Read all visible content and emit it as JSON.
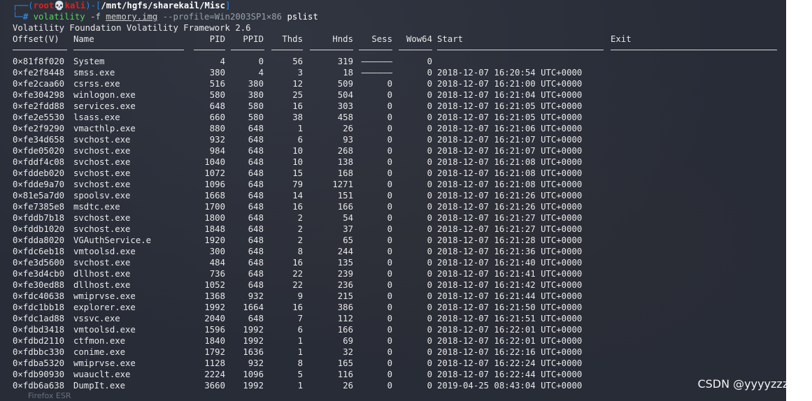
{
  "prompt": {
    "user": "root",
    "skull": "💀",
    "host": "kali",
    "path": "/mnt/hgfs/sharekail/Misc",
    "hash": "#",
    "command": "volatility",
    "flag": "-f",
    "file": "memory.img",
    "profile": "--profile=Win2003SP1×86",
    "plugin": "pslist"
  },
  "banner": "Volatility Foundation Volatility Framework 2.6",
  "headers": {
    "offset": "Offset(V)",
    "name": "Name",
    "pid": "PID",
    "ppid": "PPID",
    "thds": "Thds",
    "hnds": "Hnds",
    "sess": "Sess",
    "wow64": "Wow64",
    "start": "Start",
    "exit": "Exit"
  },
  "rows": [
    {
      "offset": "0×81f8f020",
      "name": "System",
      "pid": "4",
      "ppid": "0",
      "thds": "56",
      "hnds": "319",
      "sess": "——————",
      "wow64": "0",
      "start": ""
    },
    {
      "offset": "0×fe2f8448",
      "name": "smss.exe",
      "pid": "380",
      "ppid": "4",
      "thds": "3",
      "hnds": "18",
      "sess": "——————",
      "wow64": "0",
      "start": "2018-12-07 16:20:54 UTC+0000"
    },
    {
      "offset": "0×fe2caa60",
      "name": "csrss.exe",
      "pid": "516",
      "ppid": "380",
      "thds": "12",
      "hnds": "509",
      "sess": "0",
      "wow64": "0",
      "start": "2018-12-07 16:21:00 UTC+0000"
    },
    {
      "offset": "0×fe304298",
      "name": "winlogon.exe",
      "pid": "580",
      "ppid": "380",
      "thds": "25",
      "hnds": "504",
      "sess": "0",
      "wow64": "0",
      "start": "2018-12-07 16:21:04 UTC+0000"
    },
    {
      "offset": "0×fe2fdd88",
      "name": "services.exe",
      "pid": "648",
      "ppid": "580",
      "thds": "16",
      "hnds": "303",
      "sess": "0",
      "wow64": "0",
      "start": "2018-12-07 16:21:05 UTC+0000"
    },
    {
      "offset": "0×fe2e5530",
      "name": "lsass.exe",
      "pid": "660",
      "ppid": "580",
      "thds": "38",
      "hnds": "458",
      "sess": "0",
      "wow64": "0",
      "start": "2018-12-07 16:21:05 UTC+0000"
    },
    {
      "offset": "0×fe2f9290",
      "name": "vmacthlp.exe",
      "pid": "880",
      "ppid": "648",
      "thds": "1",
      "hnds": "26",
      "sess": "0",
      "wow64": "0",
      "start": "2018-12-07 16:21:06 UTC+0000"
    },
    {
      "offset": "0×fe34d658",
      "name": "svchost.exe",
      "pid": "932",
      "ppid": "648",
      "thds": "6",
      "hnds": "93",
      "sess": "0",
      "wow64": "0",
      "start": "2018-12-07 16:21:07 UTC+0000"
    },
    {
      "offset": "0×fde05020",
      "name": "svchost.exe",
      "pid": "984",
      "ppid": "648",
      "thds": "10",
      "hnds": "268",
      "sess": "0",
      "wow64": "0",
      "start": "2018-12-07 16:21:07 UTC+0000"
    },
    {
      "offset": "0×fddf4c08",
      "name": "svchost.exe",
      "pid": "1040",
      "ppid": "648",
      "thds": "10",
      "hnds": "138",
      "sess": "0",
      "wow64": "0",
      "start": "2018-12-07 16:21:08 UTC+0000"
    },
    {
      "offset": "0×fddeb020",
      "name": "svchost.exe",
      "pid": "1072",
      "ppid": "648",
      "thds": "15",
      "hnds": "168",
      "sess": "0",
      "wow64": "0",
      "start": "2018-12-07 16:21:08 UTC+0000"
    },
    {
      "offset": "0×fdde9a70",
      "name": "svchost.exe",
      "pid": "1096",
      "ppid": "648",
      "thds": "79",
      "hnds": "1271",
      "sess": "0",
      "wow64": "0",
      "start": "2018-12-07 16:21:08 UTC+0000"
    },
    {
      "offset": "0×81e5a7d0",
      "name": "spoolsv.exe",
      "pid": "1668",
      "ppid": "648",
      "thds": "14",
      "hnds": "151",
      "sess": "0",
      "wow64": "0",
      "start": "2018-12-07 16:21:26 UTC+0000"
    },
    {
      "offset": "0×fe7385e8",
      "name": "msdtc.exe",
      "pid": "1700",
      "ppid": "648",
      "thds": "16",
      "hnds": "166",
      "sess": "0",
      "wow64": "0",
      "start": "2018-12-07 16:21:26 UTC+0000"
    },
    {
      "offset": "0×fddb7b18",
      "name": "svchost.exe",
      "pid": "1800",
      "ppid": "648",
      "thds": "2",
      "hnds": "54",
      "sess": "0",
      "wow64": "0",
      "start": "2018-12-07 16:21:27 UTC+0000"
    },
    {
      "offset": "0×fddb1020",
      "name": "svchost.exe",
      "pid": "1848",
      "ppid": "648",
      "thds": "2",
      "hnds": "37",
      "sess": "0",
      "wow64": "0",
      "start": "2018-12-07 16:21:27 UTC+0000"
    },
    {
      "offset": "0×fdda8020",
      "name": "VGAuthService.e",
      "pid": "1920",
      "ppid": "648",
      "thds": "2",
      "hnds": "65",
      "sess": "0",
      "wow64": "0",
      "start": "2018-12-07 16:21:28 UTC+0000"
    },
    {
      "offset": "0×fdc6eb18",
      "name": "vmtoolsd.exe",
      "pid": "300",
      "ppid": "648",
      "thds": "8",
      "hnds": "244",
      "sess": "0",
      "wow64": "0",
      "start": "2018-12-07 16:21:36 UTC+0000"
    },
    {
      "offset": "0×fe3d5600",
      "name": "svchost.exe",
      "pid": "484",
      "ppid": "648",
      "thds": "16",
      "hnds": "135",
      "sess": "0",
      "wow64": "0",
      "start": "2018-12-07 16:21:40 UTC+0000"
    },
    {
      "offset": "0×fe3d4cb0",
      "name": "dllhost.exe",
      "pid": "736",
      "ppid": "648",
      "thds": "22",
      "hnds": "239",
      "sess": "0",
      "wow64": "0",
      "start": "2018-12-07 16:21:41 UTC+0000"
    },
    {
      "offset": "0×fe30ed88",
      "name": "dllhost.exe",
      "pid": "1052",
      "ppid": "648",
      "thds": "22",
      "hnds": "236",
      "sess": "0",
      "wow64": "0",
      "start": "2018-12-07 16:21:42 UTC+0000"
    },
    {
      "offset": "0×fdc40638",
      "name": "wmiprvse.exe",
      "pid": "1368",
      "ppid": "932",
      "thds": "9",
      "hnds": "215",
      "sess": "0",
      "wow64": "0",
      "start": "2018-12-07 16:21:44 UTC+0000"
    },
    {
      "offset": "0×fdc1bb18",
      "name": "explorer.exe",
      "pid": "1992",
      "ppid": "1664",
      "thds": "16",
      "hnds": "386",
      "sess": "0",
      "wow64": "0",
      "start": "2018-12-07 16:21:50 UTC+0000"
    },
    {
      "offset": "0×fdc1ad88",
      "name": "vssvc.exe",
      "pid": "2040",
      "ppid": "648",
      "thds": "7",
      "hnds": "112",
      "sess": "0",
      "wow64": "0",
      "start": "2018-12-07 16:21:51 UTC+0000"
    },
    {
      "offset": "0×fdbd3418",
      "name": "vmtoolsd.exe",
      "pid": "1596",
      "ppid": "1992",
      "thds": "6",
      "hnds": "166",
      "sess": "0",
      "wow64": "0",
      "start": "2018-12-07 16:22:01 UTC+0000"
    },
    {
      "offset": "0×fdbd2110",
      "name": "ctfmon.exe",
      "pid": "1840",
      "ppid": "1992",
      "thds": "1",
      "hnds": "69",
      "sess": "0",
      "wow64": "0",
      "start": "2018-12-07 16:22:01 UTC+0000"
    },
    {
      "offset": "0×fdbbc330",
      "name": "conime.exe",
      "pid": "1792",
      "ppid": "1636",
      "thds": "1",
      "hnds": "32",
      "sess": "0",
      "wow64": "0",
      "start": "2018-12-07 16:22:16 UTC+0000"
    },
    {
      "offset": "0×fdba5320",
      "name": "wmiprvse.exe",
      "pid": "1128",
      "ppid": "932",
      "thds": "8",
      "hnds": "165",
      "sess": "0",
      "wow64": "0",
      "start": "2018-12-07 16:22:24 UTC+0000"
    },
    {
      "offset": "0×fdb90930",
      "name": "wuauclt.exe",
      "pid": "2224",
      "ppid": "1096",
      "thds": "5",
      "hnds": "116",
      "sess": "0",
      "wow64": "0",
      "start": "2018-12-07 16:22:44 UTC+0000"
    },
    {
      "offset": "0×fdb6a638",
      "name": "DumpIt.exe",
      "pid": "3660",
      "ppid": "1992",
      "thds": "1",
      "hnds": "26",
      "sess": "0",
      "wow64": "0",
      "start": "2019-04-25 08:43:04 UTC+0000"
    }
  ],
  "watermark": "CSDN @yyyyzzzllll",
  "faded_taskbar_text": "Firefox ESR",
  "colors": {
    "background": "#272c37",
    "prompt_red": "#e02020",
    "prompt_blue": "#2e86de",
    "command_green": "#5ad35a",
    "text": "#e8e8e8"
  }
}
